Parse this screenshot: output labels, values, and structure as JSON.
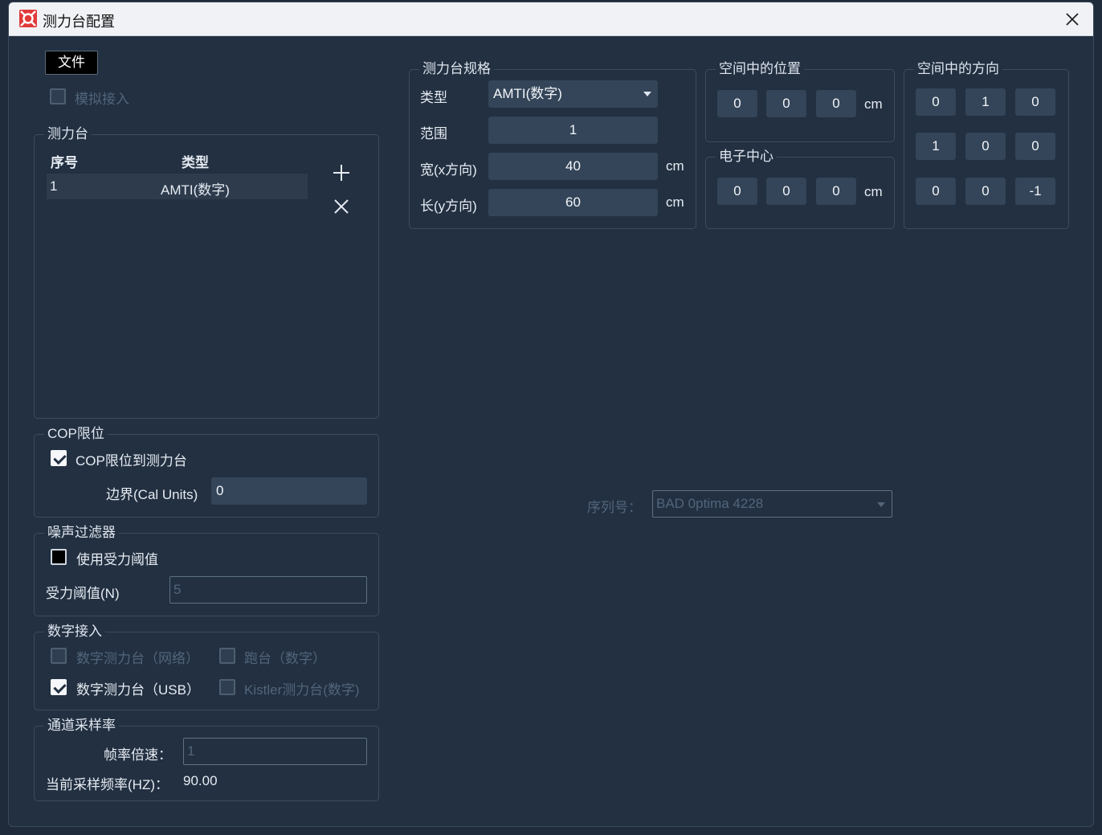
{
  "window": {
    "title": "测力台配置"
  },
  "file_button": "文件",
  "simulate": {
    "label": "模拟接入",
    "checked": false
  },
  "plates": {
    "title": "测力台",
    "columns": [
      "序号",
      "类型"
    ],
    "rows": [
      {
        "index": "1",
        "type": "AMTI(数字)"
      }
    ]
  },
  "cop": {
    "title": "COP限位",
    "limit_label": "COP限位到测力台",
    "limit_checked": true,
    "border_label": "边界(Cal Units)",
    "border_value": "0"
  },
  "noise": {
    "title": "噪声过滤器",
    "use_threshold_label": "使用受力阈值",
    "threshold_label": "受力阈值(N)",
    "threshold_value": "5"
  },
  "digital": {
    "title": "数字接入",
    "net_label": "数字测力台（网络）",
    "treadmill_label": "跑台（数字）",
    "usb_label": "数字测力台（USB）",
    "kistler_label": "Kistler测力台(数字)"
  },
  "sampling": {
    "title": "通道采样率",
    "multiplier_label": "帧率倍速：",
    "multiplier_value": "1",
    "current_label": "当前采样频率(HZ)：",
    "current_value": "90.00"
  },
  "spec": {
    "title": "测力台规格",
    "type_label": "类型",
    "type_value": "AMTI(数字)",
    "range_label": "范围",
    "range_value": "1",
    "width_label": "宽(x方向)",
    "width_value": "40",
    "length_label": "长(y方向)",
    "length_value": "60",
    "unit": "cm"
  },
  "position": {
    "title": "空间中的位置",
    "values": [
      "0",
      "0",
      "0"
    ],
    "unit": "cm"
  },
  "electric_center": {
    "title": "电子中心",
    "values": [
      "0",
      "0",
      "0"
    ],
    "unit": "cm"
  },
  "orientation": {
    "title": "空间中的方向",
    "values": [
      "0",
      "1",
      "0",
      "1",
      "0",
      "0",
      "0",
      "0",
      "-1"
    ]
  },
  "serial": {
    "label": "序列号：",
    "value": "BAD 0ptima 4228"
  }
}
